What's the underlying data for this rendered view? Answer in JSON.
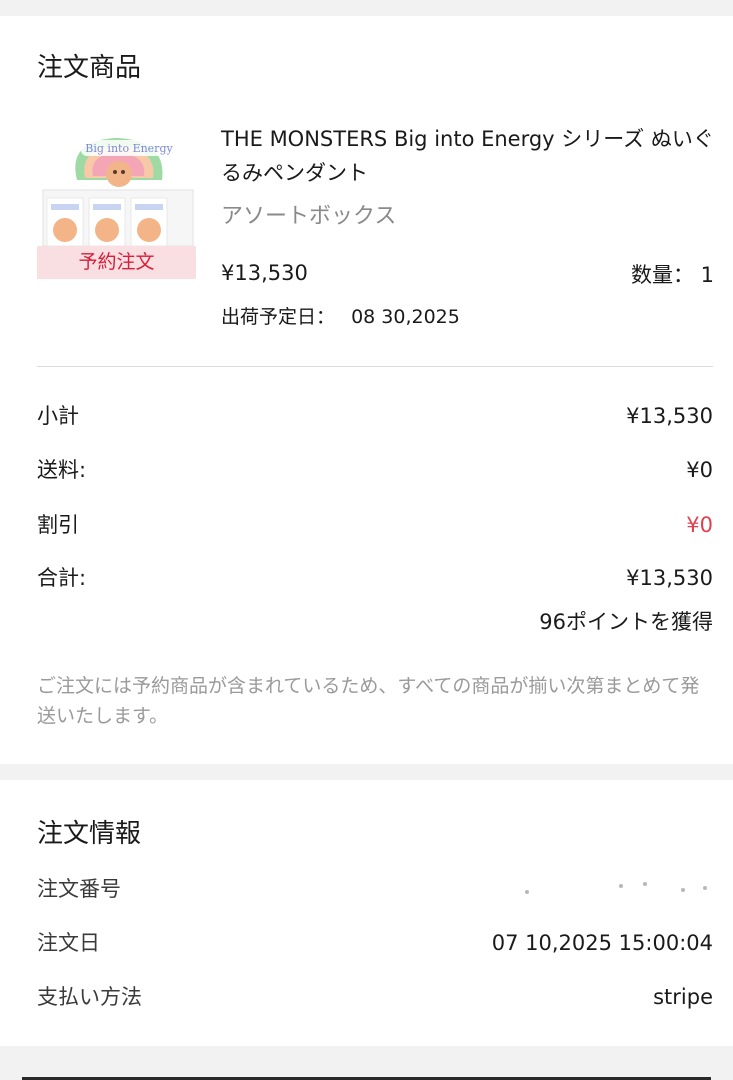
{
  "order_items": {
    "title": "注文商品",
    "product": {
      "name": "THE MONSTERS Big into Energy シリーズ ぬいぐるみペンダント",
      "variant": "アソートボックス",
      "price": "¥13,530",
      "quantity_label": "数量： 1",
      "ship_date_label": "出荷予定日：",
      "ship_date": "08 30,2025",
      "badge": "予約注文",
      "thumbnail_logo": "Big into Energy"
    },
    "summary": {
      "subtotal_label": "小計",
      "subtotal": "¥13,530",
      "shipping_label": "送料:",
      "shipping": "¥0",
      "discount_label": "割引",
      "discount": "¥0",
      "total_label": "合計:",
      "total": "¥13,530",
      "points": "96ポイントを獲得"
    },
    "notice": "ご注文には予約商品が含まれているため、すべての商品が揃い次第まとめて発送いたします。"
  },
  "order_info": {
    "title": "注文情報",
    "order_number_label": "注文番号",
    "order_date_label": "注文日",
    "order_date": "07 10,2025 15:00:04",
    "payment_method_label": "支払い方法",
    "payment_method": "stripe"
  },
  "colors": {
    "accent_red": "#e0404f",
    "badge_bg": "#f9dfe2",
    "muted_text": "#9a9a9a"
  }
}
